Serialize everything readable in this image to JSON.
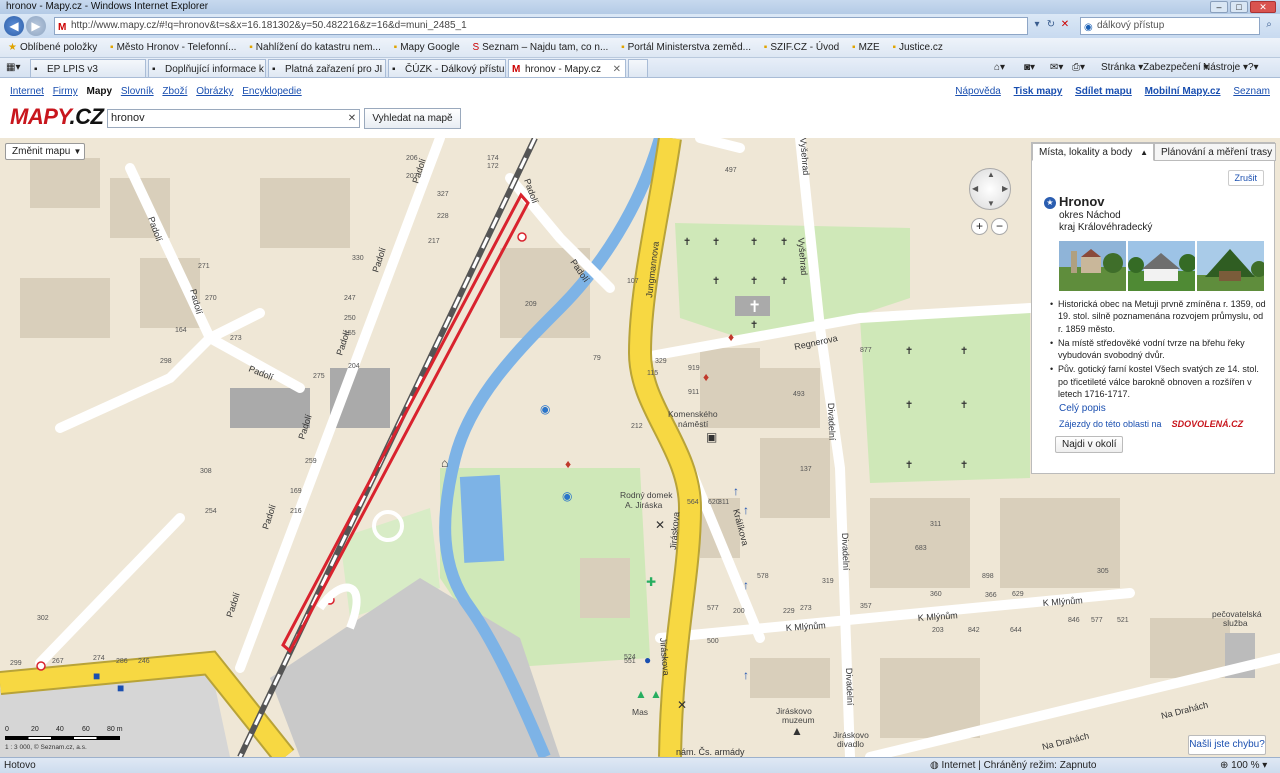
{
  "window": {
    "title": "hronov - Mapy.cz - Windows Internet Explorer",
    "url": "http://www.mapy.cz/#!q=hronov&t=s&x=16.181302&y=50.482216&z=16&d=muni_2485_1",
    "search_provider_text": "dálkový přístup"
  },
  "favorites": {
    "label": "Oblíbené položky",
    "items": [
      "Město Hronov - Telefonní...",
      "Nahlížení do katastru nem...",
      "Mapy Google",
      "Seznam – Najdu tam, co n...",
      "Portál Ministerstva zeměd...",
      "SZIF.CZ - Úvod",
      "MZE",
      "Justice.cz"
    ]
  },
  "tabs": [
    {
      "label": "EP LPIS v3"
    },
    {
      "label": "Doplňující informace k De..."
    },
    {
      "label": "Platná zařazení pro JI (EAF..."
    },
    {
      "label": "ČÚZK - Dálkový přístup k ..."
    },
    {
      "label": "hronov - Mapy.cz"
    }
  ],
  "command_bar": {
    "page": "Stránka",
    "security": "Zabezpečení",
    "tools": "Nástroje"
  },
  "site": {
    "nav": [
      "Internet",
      "Firmy",
      "Mapy",
      "Slovník",
      "Zboží",
      "Obrázky",
      "Encyklopedie"
    ],
    "current_nav": "Mapy",
    "right_nav": {
      "help": "Nápověda",
      "print": "Tisk mapy",
      "share": "Sdílet mapu",
      "mobile": "Mobilní Mapy.cz",
      "seznam": "Seznam"
    },
    "logo_main": "MAPY",
    "logo_dot": ".CZ",
    "search_value": "hronov",
    "search_button": "Vyhledat na mapě"
  },
  "map": {
    "change_map": "Změnit mapu",
    "scale_text": "1 : 3 000, © Seznam.cz, a.s.",
    "scale_ticks": [
      "0",
      "20",
      "40",
      "60",
      "80 m"
    ],
    "feedback": "Našli jste chybu?",
    "street_labels": {
      "padoli": "Padolí",
      "jungmannova": "Jungmannova",
      "regnerova": "Regnerova",
      "vysehrad": "Vyšehrad",
      "divadelni": "Divadelní",
      "kralikova": "Králíkova",
      "jiraskova": "Jiráskova",
      "k_mlynum": "K Mlýnům",
      "na_drahach": "Na Drahách",
      "nam": "nám. Čs. armády"
    },
    "place_labels": {
      "komenskeho": "Komenského náměstí",
      "rodny_dom": "Rodný domek A. Jiráska",
      "muzeum": "Jiráskovo muzeum",
      "divadlo": "Jiráskovo divadlo",
      "pecovatelska": "pečovatelská služba",
      "mas": "Mas"
    },
    "house_numbers": [
      "206",
      "207",
      "174",
      "172",
      "327",
      "228",
      "217",
      "330",
      "247",
      "250",
      "155",
      "275",
      "204",
      "273",
      "270",
      "164",
      "298",
      "271",
      "308",
      "254",
      "259",
      "169",
      "216",
      "302",
      "299",
      "267",
      "274",
      "286",
      "246",
      "209",
      "79",
      "212",
      "115",
      "107",
      "329",
      "919",
      "911",
      "137",
      "497",
      "877",
      "493",
      "578",
      "577",
      "500",
      "200",
      "319",
      "273",
      "229",
      "311",
      "683",
      "898",
      "305",
      "357",
      "360",
      "366",
      "629",
      "203",
      "842",
      "644",
      "846",
      "577",
      "521",
      "524",
      "551",
      "564",
      "620",
      "311"
    ]
  },
  "panel": {
    "tab_places": "Místa, lokality a body",
    "tab_planning": "Plánování a měření trasy",
    "close": "Zrušit",
    "title": "Hronov",
    "district": "okres Náchod",
    "region": "kraj Královéhradecký",
    "bullets": [
      "Historická obec na Metuji prvně zmíněna r. 1359, od 19. stol. silně poznamenána rozvojem průmyslu, od r. 1859 město.",
      "Na místě středověké vodní tvrze na břehu řeky vybudován svobodný dvůr.",
      "Pův. gotický farní kostel Všech svatých ze 14. stol. po třicetileté válce barokně obnoven a rozšířen v letech 1716-1717."
    ],
    "more": "Celý popis",
    "trips": "Zájezdy do této oblasti na",
    "trips_logo": "SDOVOLENÁ.CZ",
    "near": "Najdi v okolí"
  },
  "status": {
    "left": "Hotovo",
    "zone": "Internet | Chráněný režim: Zapnuto",
    "zoom": "100 %"
  },
  "colors": {
    "main_road": "#f7d842",
    "river": "#7db3e6",
    "park": "#cfe8b8",
    "railway_highlight": "#d9232e",
    "logo_red": "#c8161d"
  }
}
